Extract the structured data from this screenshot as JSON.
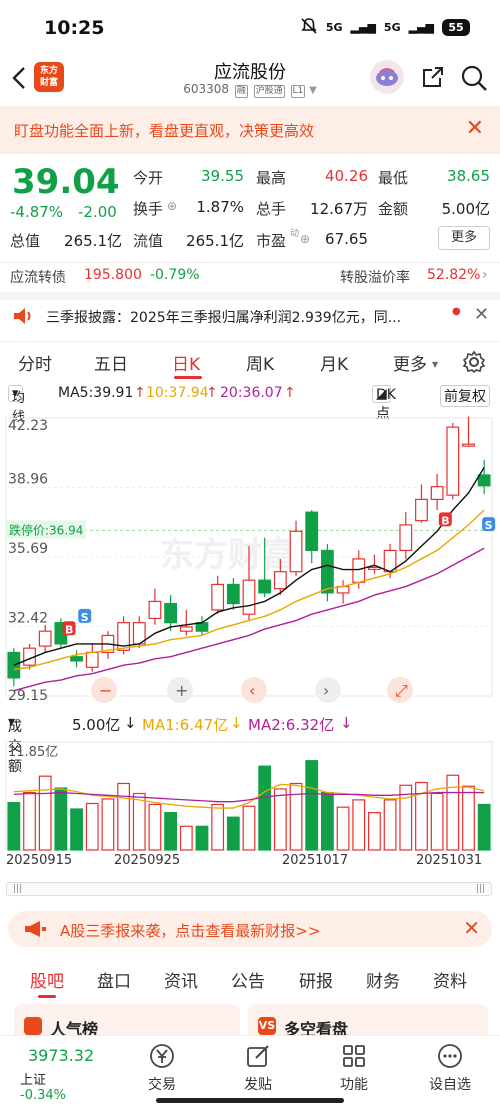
{
  "status": {
    "time": "10:25",
    "sig1": "5G",
    "sig2": "5G",
    "battery": "55"
  },
  "header": {
    "title": "应流股份",
    "code": "603308",
    "tag_rong": "融",
    "tag_hgt": "沪股通",
    "tag_l1": "L1"
  },
  "banner": {
    "text": "盯盘功能全面上新，看盘更直观，决策更高效"
  },
  "quote": {
    "price": "39.04",
    "change_pct": "-4.87%",
    "change": "-2.00",
    "open_label": "今开",
    "open": "39.55",
    "high_label": "最高",
    "high": "40.26",
    "low_label": "最低",
    "low": "38.65",
    "turnover_label": "换手",
    "turnover": "1.87%",
    "volume_label": "总手",
    "volume": "12.67万",
    "amount_label": "金额",
    "amount": "5.00亿",
    "mktcap_label": "总值",
    "mktcap": "265.1亿",
    "float_label": "流值",
    "float": "265.1亿",
    "pe_label": "市盈",
    "pe_sup": "动",
    "pe": "67.65",
    "more": "更多"
  },
  "bond": {
    "label": "应流转债",
    "price": "195.800",
    "pct": "-0.79%",
    "premium_label": "转股溢价率",
    "premium": "52.82%"
  },
  "notice": {
    "text": "三季报披露：2025年三季报归属净利润2.939亿元，同..."
  },
  "tabs": [
    "分时",
    "五日",
    "日K",
    "周K",
    "月K",
    "更多"
  ],
  "chart_bar": {
    "ma_label": "均线",
    "ma5": "MA5:39.91",
    "ma10": "10:37.94",
    "ma20": "20:36.07",
    "dk": "DK点",
    "adj": "前复权"
  },
  "vol_bar": {
    "label": "成交额",
    "value": "5.00亿",
    "ma1": "MA1:6.47亿",
    "ma2": "MA2:6.32亿"
  },
  "colors": {
    "up": "#e93030",
    "down": "#11a047",
    "ma5": "#111111",
    "ma10": "#e8a800",
    "ma20": "#b0209a",
    "accent": "#e8491b"
  },
  "chart_data": {
    "type": "candlestick",
    "y_ticks": [
      "42.23",
      "38.96",
      "35.69",
      "32.42",
      "29.15"
    ],
    "ylim": [
      29.15,
      42.23
    ],
    "limit_down_label": "跌停价:36.94",
    "limit_down": 36.94,
    "vol_max_label": "11.85亿",
    "x_labels": [
      "20250915",
      "20250925",
      "20251017",
      "20251031"
    ],
    "candles": [
      {
        "o": 31.2,
        "c": 30.0,
        "h": 31.4,
        "l": 29.6,
        "v": 5.2
      },
      {
        "o": 30.6,
        "c": 31.4,
        "h": 31.6,
        "l": 30.4,
        "v": 6.3
      },
      {
        "o": 31.5,
        "c": 32.2,
        "h": 32.5,
        "l": 31.2,
        "v": 8.1
      },
      {
        "o": 32.6,
        "c": 31.6,
        "h": 32.8,
        "l": 31.4,
        "v": 6.8
      },
      {
        "o": 31.0,
        "c": 30.8,
        "h": 31.3,
        "l": 30.5,
        "v": 4.5
      },
      {
        "o": 30.5,
        "c": 31.2,
        "h": 31.6,
        "l": 30.3,
        "v": 5.1
      },
      {
        "o": 31.2,
        "c": 32.0,
        "h": 32.2,
        "l": 30.9,
        "v": 5.6
      },
      {
        "o": 31.3,
        "c": 32.6,
        "h": 32.9,
        "l": 31.1,
        "v": 7.3
      },
      {
        "o": 31.6,
        "c": 32.6,
        "h": 32.9,
        "l": 31.4,
        "v": 6.2
      },
      {
        "o": 32.8,
        "c": 33.6,
        "h": 34.2,
        "l": 32.5,
        "v": 5.0
      },
      {
        "o": 33.5,
        "c": 32.6,
        "h": 33.9,
        "l": 32.2,
        "v": 4.1
      },
      {
        "o": 32.2,
        "c": 32.4,
        "h": 33.2,
        "l": 32.0,
        "v": 2.6
      },
      {
        "o": 32.6,
        "c": 32.2,
        "h": 32.9,
        "l": 32.0,
        "v": 2.6
      },
      {
        "o": 33.2,
        "c": 34.4,
        "h": 34.8,
        "l": 33.0,
        "v": 5.0
      },
      {
        "o": 34.4,
        "c": 33.5,
        "h": 34.7,
        "l": 33.2,
        "v": 3.6
      },
      {
        "o": 33.0,
        "c": 34.6,
        "h": 36.2,
        "l": 32.7,
        "v": 4.8
      },
      {
        "o": 34.6,
        "c": 34.0,
        "h": 36.6,
        "l": 33.8,
        "v": 9.2
      },
      {
        "o": 34.2,
        "c": 35.0,
        "h": 35.6,
        "l": 33.9,
        "v": 6.7
      },
      {
        "o": 35.0,
        "c": 36.9,
        "h": 37.4,
        "l": 34.8,
        "v": 7.3
      },
      {
        "o": 37.8,
        "c": 36.0,
        "h": 37.9,
        "l": 35.4,
        "v": 9.8
      },
      {
        "o": 36.0,
        "c": 34.0,
        "h": 36.3,
        "l": 33.6,
        "v": 6.3
      },
      {
        "o": 34.0,
        "c": 34.3,
        "h": 34.6,
        "l": 33.5,
        "v": 4.7
      },
      {
        "o": 34.5,
        "c": 35.6,
        "h": 36.0,
        "l": 34.2,
        "v": 5.5
      },
      {
        "o": 35.2,
        "c": 35.2,
        "h": 35.8,
        "l": 34.9,
        "v": 4.1
      },
      {
        "o": 35.0,
        "c": 36.0,
        "h": 36.3,
        "l": 34.7,
        "v": 5.5
      },
      {
        "o": 36.0,
        "c": 37.2,
        "h": 37.8,
        "l": 35.6,
        "v": 7.1
      },
      {
        "o": 37.4,
        "c": 38.4,
        "h": 39.1,
        "l": 37.3,
        "v": 7.4
      },
      {
        "o": 38.4,
        "c": 39.0,
        "h": 39.6,
        "l": 37.9,
        "v": 6.2
      },
      {
        "o": 38.6,
        "c": 41.8,
        "h": 42.0,
        "l": 38.4,
        "v": 8.2
      },
      {
        "o": 41.0,
        "c": 41.0,
        "h": 42.3,
        "l": 40.9,
        "v": 7.0
      },
      {
        "o": 39.55,
        "c": 39.04,
        "h": 40.26,
        "l": 38.65,
        "v": 5.0
      }
    ],
    "ma5": [
      30.6,
      30.9,
      31.2,
      31.4,
      31.6,
      31.6,
      31.6,
      31.5,
      31.6,
      32.1,
      32.4,
      32.5,
      32.6,
      33.1,
      33.3,
      33.4,
      33.6,
      34.0,
      34.6,
      35.1,
      35.3,
      35.1,
      35.1,
      35.3,
      35.0,
      35.5,
      36.2,
      36.9,
      37.9,
      38.7,
      39.9
    ],
    "ma10": [
      30.4,
      30.5,
      30.7,
      30.9,
      31.1,
      31.2,
      31.3,
      31.4,
      31.5,
      31.6,
      31.8,
      31.9,
      32.0,
      32.3,
      32.5,
      32.7,
      32.9,
      33.2,
      33.6,
      33.9,
      34.2,
      34.3,
      34.5,
      34.7,
      34.9,
      35.2,
      35.6,
      36.0,
      36.6,
      37.2,
      37.9
    ],
    "ma20": [
      29.4,
      29.6,
      29.8,
      29.9,
      30.1,
      30.2,
      30.4,
      30.6,
      30.7,
      30.9,
      31.0,
      31.2,
      31.4,
      31.6,
      31.8,
      32.0,
      32.3,
      32.5,
      32.7,
      33.0,
      33.2,
      33.4,
      33.6,
      33.9,
      34.1,
      34.3,
      34.6,
      34.9,
      35.3,
      35.7,
      36.1
    ],
    "vma1": [
      6.4,
      6.5,
      6.6,
      6.7,
      6.4,
      6.0,
      5.9,
      5.7,
      5.5,
      5.2,
      5.0,
      4.8,
      4.7,
      4.6,
      4.6,
      5.2,
      6.4,
      7.2,
      7.1,
      6.8,
      6.3,
      6.2,
      6.0,
      5.8,
      5.6,
      5.7,
      6.2,
      6.7,
      6.9,
      6.9,
      6.5
    ],
    "vma2": [
      6.1,
      6.2,
      6.2,
      6.3,
      6.2,
      6.1,
      6.0,
      5.9,
      5.8,
      5.7,
      5.6,
      5.5,
      5.4,
      5.3,
      5.3,
      5.5,
      5.8,
      6.0,
      6.1,
      6.2,
      6.1,
      6.1,
      6.1,
      6.0,
      6.0,
      6.1,
      6.2,
      6.3,
      6.3,
      6.3,
      6.3
    ]
  },
  "chart_controls": [
    "-",
    "+",
    "<",
    ">",
    "zoom"
  ],
  "ad": {
    "text": "A股三季报来袭，点击查看最新财报>>"
  },
  "bottom_tabs": [
    "股吧",
    "盘口",
    "资讯",
    "公告",
    "研报",
    "财务",
    "资料"
  ],
  "cards": [
    {
      "icon": "",
      "title": "人气榜"
    },
    {
      "icon": "VS",
      "title": "多空看盘"
    }
  ],
  "nav": {
    "index_value": "3973.32",
    "index_name": "上证",
    "index_pct": "-0.34%",
    "items": [
      "交易",
      "发贴",
      "功能",
      "设自选"
    ]
  }
}
